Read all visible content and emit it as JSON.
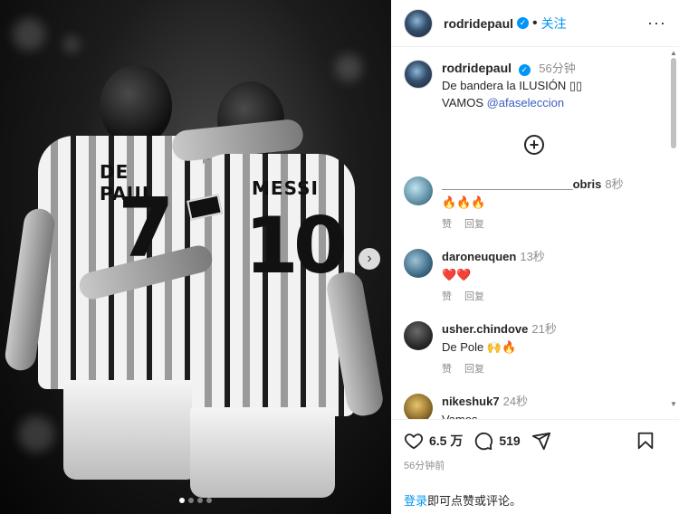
{
  "post": {
    "username": "rodridepaul",
    "follow_label": "关注",
    "more_icon": "more-horizontal-icon",
    "verified_icon": "verified-badge-icon"
  },
  "caption": {
    "username": "rodridepaul",
    "time": "56分钟",
    "line1": "De bandera la ILUSIÓN ▯▯",
    "line2_prefix": "VAMOS ",
    "mention": "@afaseleccion"
  },
  "load_more_icon": "plus-circle-icon",
  "comments": [
    {
      "user": "____________________obris",
      "time": "8秒",
      "text": "🔥🔥🔥",
      "like": "赞",
      "reply": "回复"
    },
    {
      "user": "daroneuquen",
      "time": "13秒",
      "text": "❤️❤️",
      "like": "赞",
      "reply": "回复"
    },
    {
      "user": "usher.chindove",
      "time": "21秒",
      "text": "De Pole 🙌🔥",
      "like": "赞",
      "reply": "回复"
    },
    {
      "user": "nikeshuk7",
      "time": "24秒",
      "text": "Vamos",
      "like": "",
      "reply": ""
    }
  ],
  "jersey": {
    "left_name": "DE PAUL",
    "left_number": "7",
    "right_name": "MESSI",
    "right_number": "10"
  },
  "actions": {
    "likes": "6.5 万",
    "comments": "519",
    "posted": "56分钟前"
  },
  "login": {
    "link": "登录",
    "rest": "即可点赞或评论。"
  },
  "carousel": {
    "dots": 4,
    "active_index": 0
  }
}
